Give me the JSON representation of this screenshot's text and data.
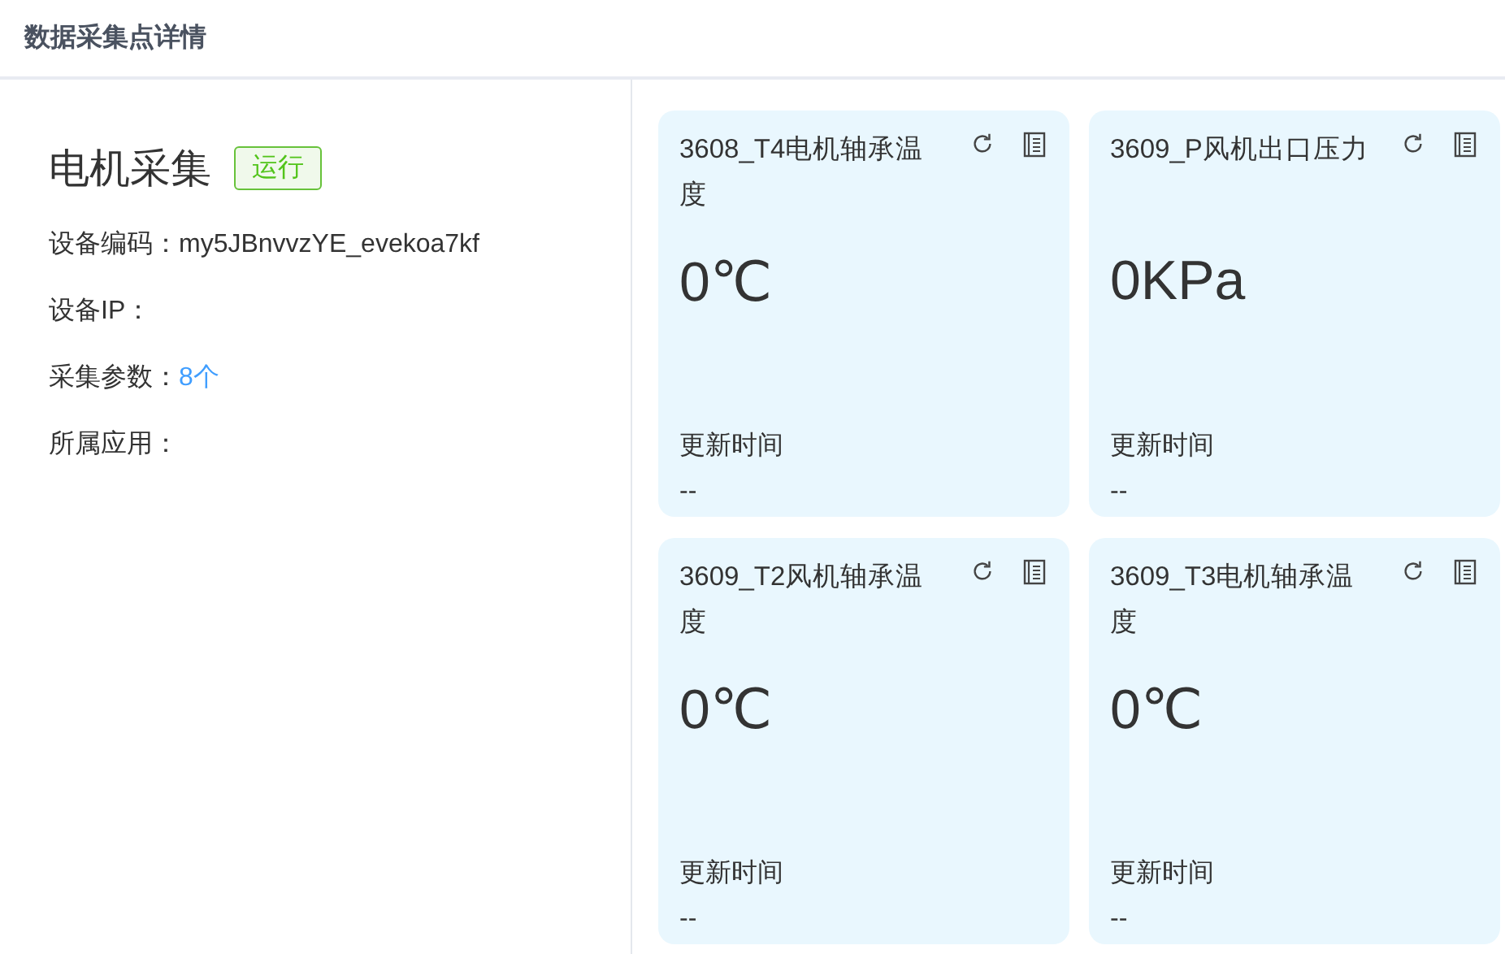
{
  "page": {
    "title": "数据采集点详情"
  },
  "device": {
    "name": "电机采集",
    "status": {
      "label": "运行",
      "kind": "running"
    },
    "fields": [
      {
        "label": "设备编码：",
        "value": "my5JBnvvzYE_evekoa7kf",
        "kind": "text"
      },
      {
        "label": "设备IP："
      },
      {
        "label": "采集参数：",
        "value": "8个",
        "kind": "link"
      },
      {
        "label": "所属应用："
      }
    ]
  },
  "points": [
    {
      "name": "3608_T4电机轴承温度",
      "value": "0℃",
      "updated_label": "更新时间",
      "updated": "--"
    },
    {
      "name": "3609_P风机出口压力",
      "value": "0KPa",
      "updated_label": "更新时间",
      "updated": "--"
    },
    {
      "name": "3609_T2风机轴承温度",
      "value": "0℃",
      "updated_label": "更新时间",
      "updated": "--"
    },
    {
      "name": "3609_T3电机轴承温度",
      "value": "0℃",
      "updated_label": "更新时间",
      "updated": "--"
    }
  ]
}
